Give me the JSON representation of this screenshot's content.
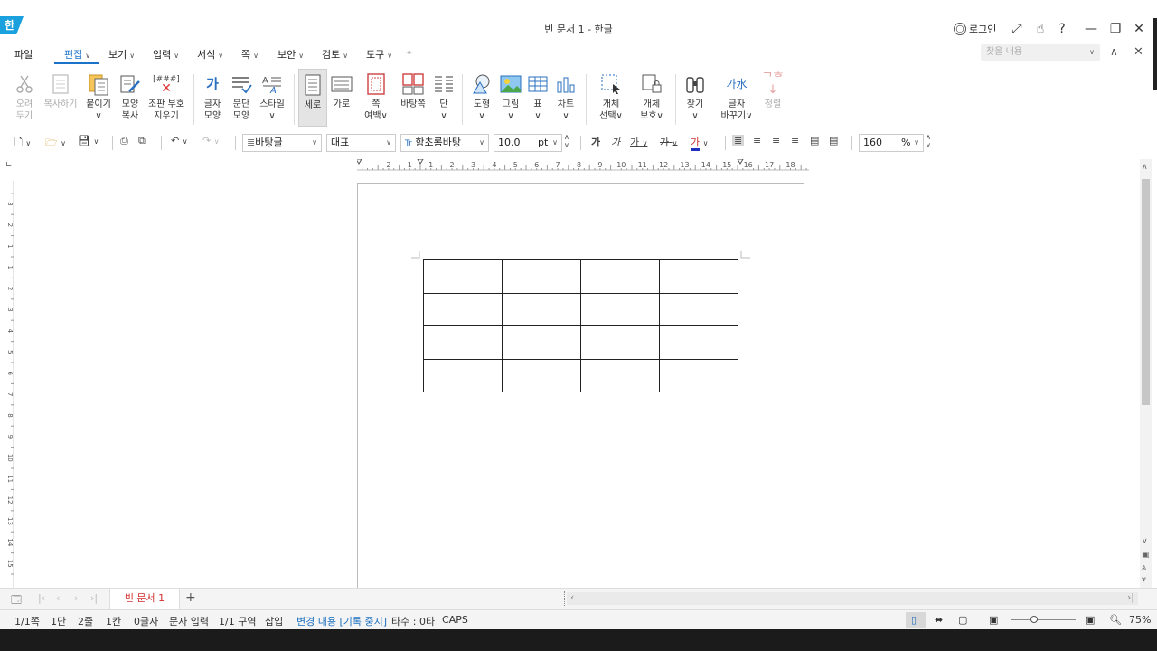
{
  "window": {
    "app_logo": "한",
    "title": "빈 문서 1 - 한글",
    "login": "로그인"
  },
  "menu": {
    "items": [
      "파일",
      "편집",
      "보기",
      "입력",
      "서식",
      "쪽",
      "보안",
      "검토",
      "도구"
    ],
    "search_placeholder": "찾을 내용"
  },
  "ribbon": {
    "cut": [
      "오려",
      "두기"
    ],
    "copy": "복사하기",
    "paste": "붙이기",
    "format_copy": [
      "모양",
      "복사"
    ],
    "clear_code": [
      "조판 부호",
      "지우기"
    ],
    "clear_code_icon_text": "[###]",
    "char_shape": [
      "글자",
      "모양"
    ],
    "para_shape": [
      "문단",
      "모양"
    ],
    "style": "스타일",
    "portrait": "세로",
    "landscape": "가로",
    "page_margin": [
      "쪽",
      "여백"
    ],
    "page_border": "바탕쪽",
    "columns": "단",
    "shape": "도형",
    "picture": "그림",
    "table": "표",
    "chart": "차트",
    "select_object": [
      "개체",
      "선택"
    ],
    "protect_object": [
      "개체",
      "보호"
    ],
    "find": "찾기",
    "replace_char": [
      "글자",
      "바꾸기"
    ],
    "replace_char_icon_text": "가水",
    "sort": "정렬"
  },
  "toolbar": {
    "style": "바탕글",
    "lang": "대표",
    "font": "함초롬바탕",
    "font_prefix": "Tr",
    "size": "10.0",
    "unit": "pt",
    "bold": "가",
    "italic": "가",
    "underline": "가",
    "strike": "가",
    "color": "가",
    "zoom": "160",
    "zoom_unit": "%"
  },
  "ruler": {
    "h_ticks": [
      "2",
      "1",
      "1",
      "2",
      "3",
      "4",
      "5",
      "6",
      "7",
      "8",
      "9",
      "10",
      "11",
      "12",
      "13",
      "14",
      "15",
      "16",
      "17",
      "18"
    ],
    "v_ticks": [
      "3",
      "2",
      "1",
      "1",
      "2",
      "3",
      "4",
      "5",
      "6",
      "7",
      "8",
      "9",
      "10",
      "11",
      "12",
      "13",
      "14",
      "15"
    ]
  },
  "table": {
    "rows": 4,
    "cols": 4
  },
  "tabs": {
    "doc_tab": "빈 문서 1",
    "add": "+"
  },
  "status": {
    "page": "1/1쪽",
    "column": "1단",
    "line": "2줄",
    "col_pos": "1칸",
    "chars": "0글자",
    "input_mode": "문자 입력",
    "section": "1/1 구역",
    "insert": "삽입",
    "track_changes": "변경 내용 [기록 중지]",
    "typing": "타수 : 0타",
    "caps": "CAPS",
    "zoom": "75%"
  },
  "colors": {
    "accent": "#1a73c8",
    "logo": "#1aa0dc",
    "tab_text": "#d03030",
    "link": "#1a6fc0"
  }
}
